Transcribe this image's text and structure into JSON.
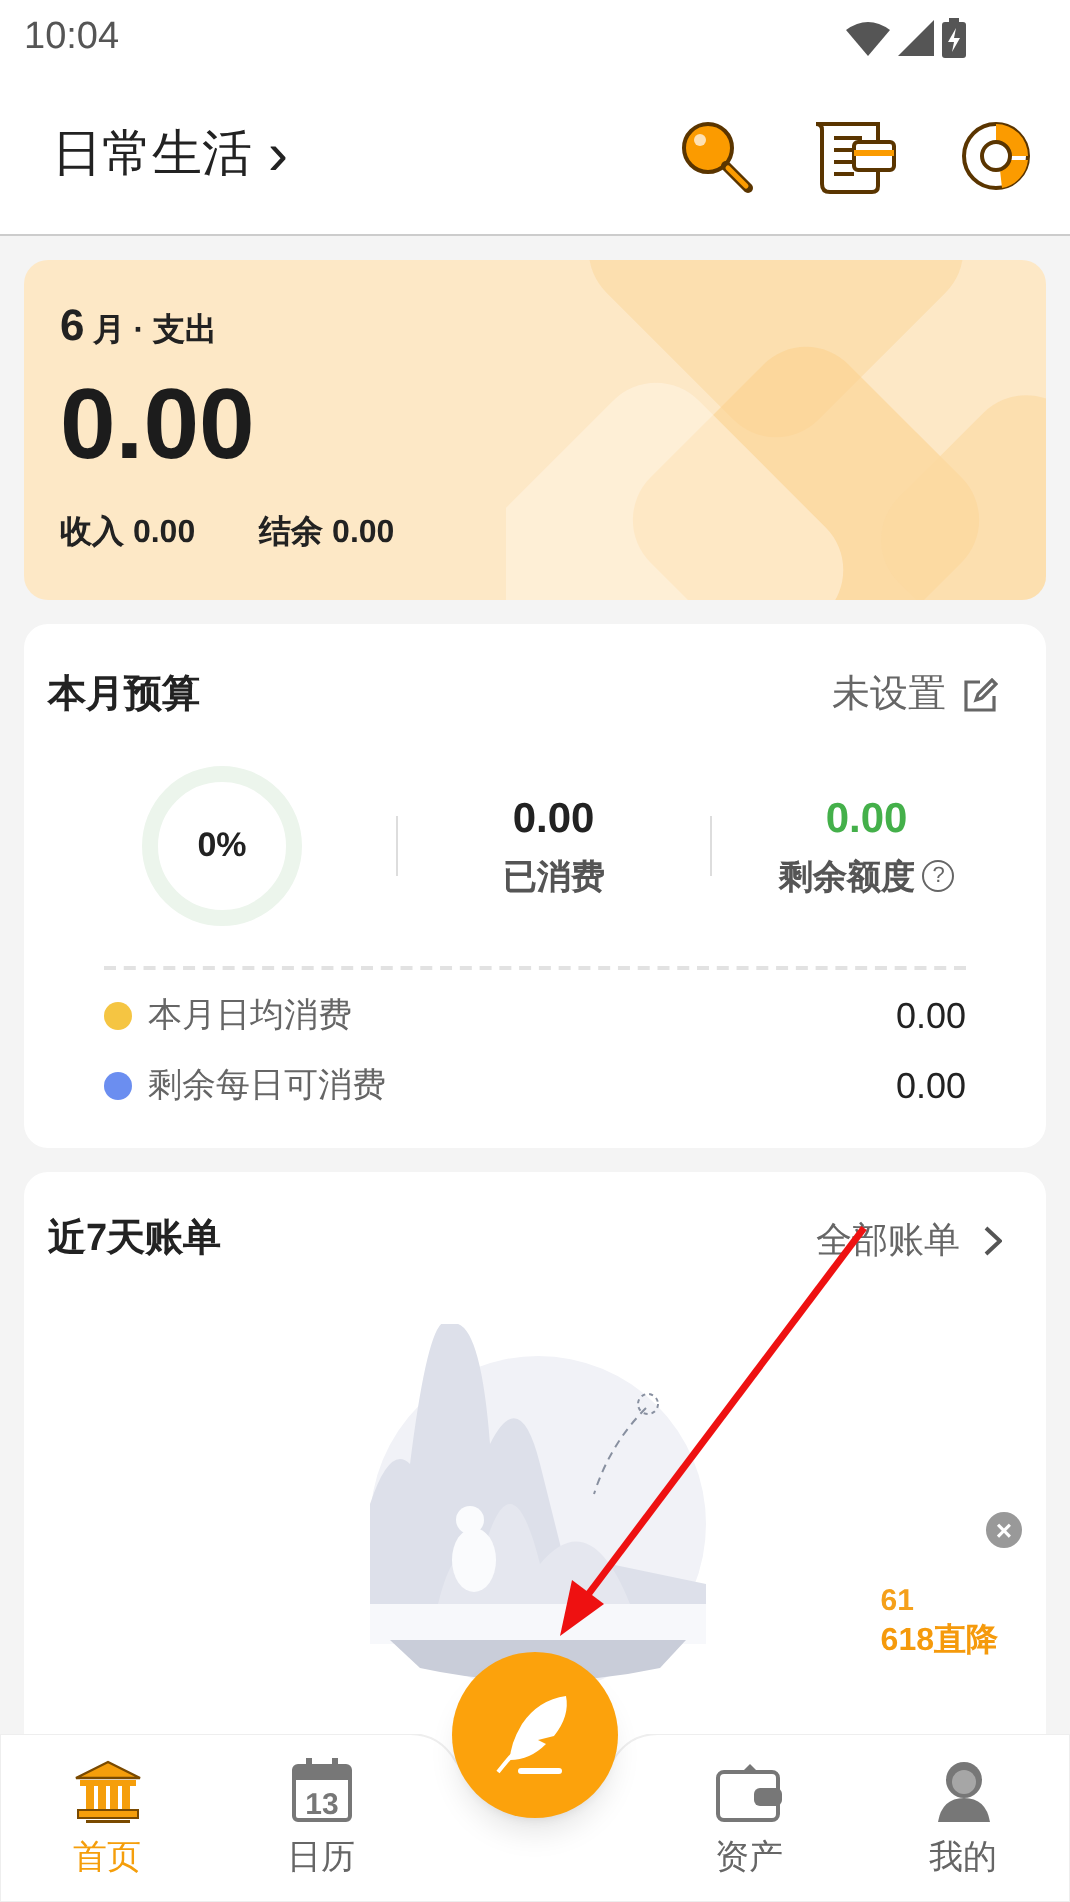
{
  "status_bar": {
    "time": "10:04"
  },
  "header": {
    "title": "日常生活",
    "chevron": "›"
  },
  "summary": {
    "month": "6",
    "month_unit": "月 · 支出",
    "amount": "0.00",
    "income_label": "收入",
    "income": "0.00",
    "balance_label": "结余",
    "balance": "0.00"
  },
  "budget": {
    "title": "本月预算",
    "status": "未设置",
    "level": 0,
    "percent": "0%",
    "spent": "0.00",
    "spent_label": "已消费",
    "remaining": "0.00",
    "remaining_label": "剩余额度",
    "help": "?",
    "rows": [
      {
        "label": "本月日均消费",
        "value": "0.00",
        "color": "#f5c542"
      },
      {
        "label": "剩余每日可消费",
        "value": "0.00",
        "color": "#6b8ef0"
      }
    ]
  },
  "recent": {
    "title": "近7天账单",
    "link": "全部账单"
  },
  "ad": {
    "close": "×",
    "line_1": "61",
    "line_2": "618直降"
  },
  "nav": [
    {
      "label": "首页",
      "kind": "bank",
      "selected": true
    },
    {
      "label": "日历",
      "kind": "calendar",
      "icon_text": "13",
      "selected": false
    },
    {
      "label": "资产",
      "kind": "wallet",
      "selected": false
    },
    {
      "label": "我的",
      "kind": "person",
      "selected": false
    }
  ]
}
